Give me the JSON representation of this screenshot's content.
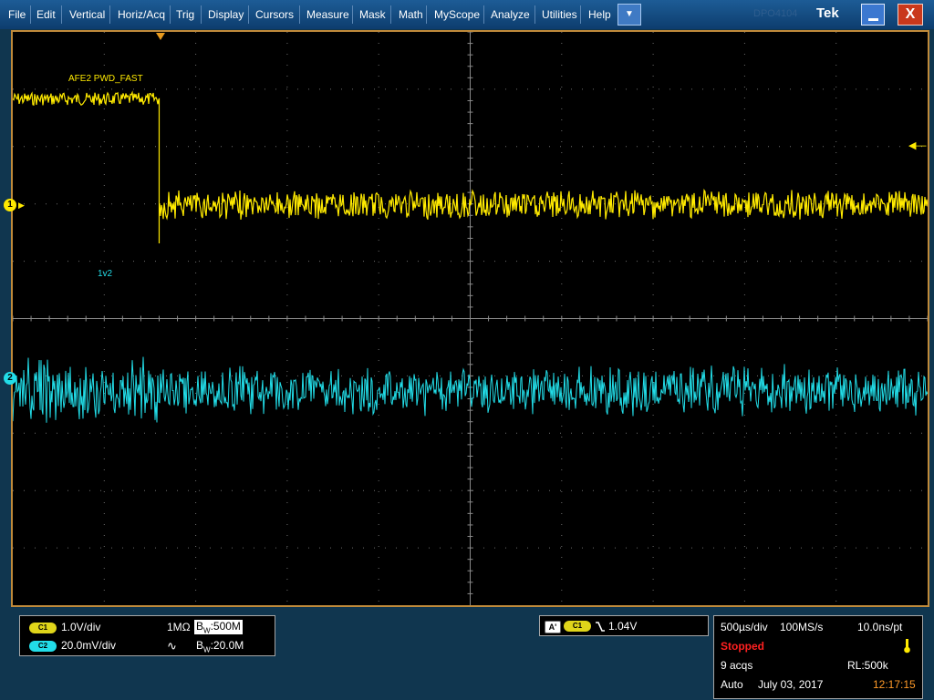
{
  "menu": {
    "items": [
      {
        "key": "file",
        "label": "File"
      },
      {
        "key": "edit",
        "label": "Edit"
      },
      {
        "key": "vertical",
        "label": "Vertical"
      },
      {
        "key": "horiz",
        "label": "Horiz/Acq"
      },
      {
        "key": "trig",
        "label": "Trig"
      },
      {
        "key": "display",
        "label": "Display"
      },
      {
        "key": "cursors",
        "label": "Cursors"
      },
      {
        "key": "measure",
        "label": "Measure"
      },
      {
        "key": "mask",
        "label": "Mask"
      },
      {
        "key": "math",
        "label": "Math"
      },
      {
        "key": "myscope",
        "label": "MyScope"
      },
      {
        "key": "analyze",
        "label": "Analyze"
      },
      {
        "key": "utilities",
        "label": "Utilities"
      },
      {
        "key": "help",
        "label": "Help"
      }
    ],
    "dropdown_icon": "chevron-down-icon",
    "brand": "Tek",
    "model": "DPO4104",
    "minimize_icon": "minimize-icon",
    "close_icon": "close-icon",
    "close_glyph": "X"
  },
  "graticule": {
    "horizontal_divisions": 10,
    "vertical_divisions": 10,
    "grid_color": "#6e6e6e"
  },
  "traces": {
    "ch1": {
      "marker": "1",
      "label": "AFE2 PWD_FAST",
      "color": "#ffea00",
      "high_level_div": 1.85,
      "low_level_div": 0,
      "edge_div": 1.6
    },
    "ch2": {
      "marker": "2",
      "label": "1v2",
      "color": "#22dde8",
      "level_div": -2.9
    },
    "trigger_marker_color": "#e89a1e"
  },
  "bottom_left": {
    "c1": {
      "badge": "C1",
      "scale": "1.0V/div",
      "coupling": "1MΩ",
      "bw_prefix": "B",
      "bw_sub": "W",
      "bw_value": ":500M"
    },
    "c2": {
      "badge": "C2",
      "scale": "20.0mV/div",
      "bw_prefix": "B",
      "bw_sub": "W",
      "bw_value": ":20.0M",
      "coupling_icon": "ac-coupling-icon"
    }
  },
  "bottom_trigger": {
    "mode_badge": "A'",
    "source_badge": "C1",
    "slope_icon": "falling-edge-icon",
    "level": "1.04V"
  },
  "bottom_right": {
    "timebase": "500µs/div",
    "sample_rate": "100MS/s",
    "resolution": "10.0ns/pt",
    "status": "Stopped",
    "acqs": "9 acqs",
    "record_length": "RL:500k",
    "trigger_mode": "Auto",
    "date": "July 03, 2017",
    "time": "12:17:15",
    "status_color": "#ff2020",
    "time_color": "#ff9a28",
    "trig_level_icon": "trigger-level-icon"
  }
}
